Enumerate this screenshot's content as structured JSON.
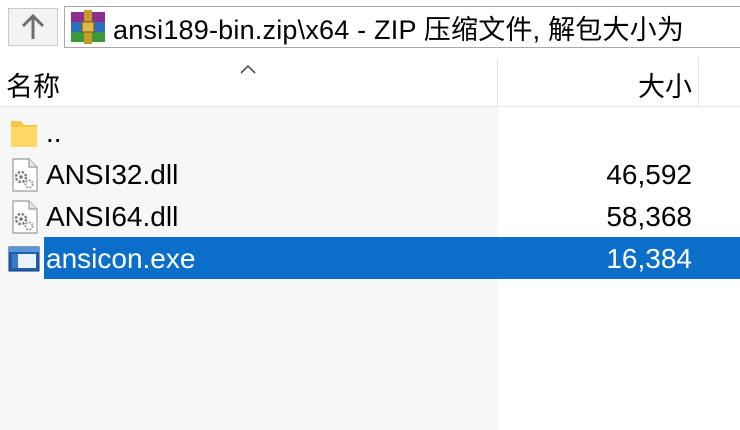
{
  "toolbar": {
    "path": "ansi189-bin.zip\\x64 - ZIP 压缩文件, 解包大小为"
  },
  "header": {
    "name_label": "名称",
    "size_label": "大小"
  },
  "files": [
    {
      "name": "..",
      "size": "",
      "icon": "folder-icon"
    },
    {
      "name": "ANSI32.dll",
      "size": "46,592",
      "icon": "dll-file-icon"
    },
    {
      "name": "ANSI64.dll",
      "size": "58,368",
      "icon": "dll-file-icon"
    },
    {
      "name": "ansicon.exe",
      "size": "16,384",
      "icon": "exe-file-icon",
      "selected": true
    }
  ],
  "colors": {
    "selection": "#0b6ec9",
    "name_column_bg": "#f7f7f7"
  }
}
